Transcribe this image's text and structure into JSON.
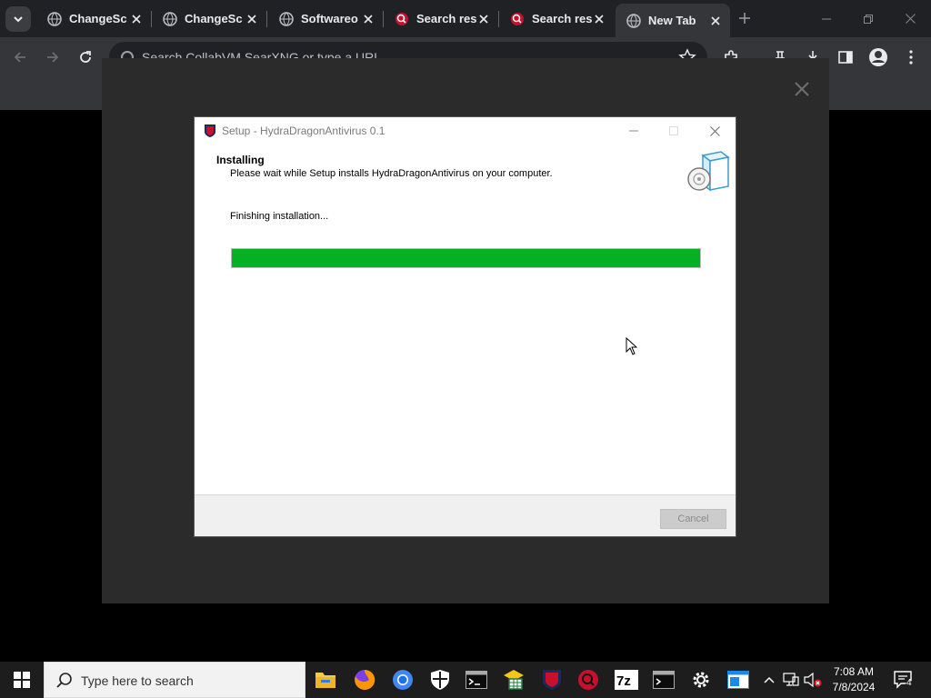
{
  "browser": {
    "tabs": [
      {
        "title": "ChangeSc",
        "favicon": "globe-icon",
        "active": false
      },
      {
        "title": "ChangeSc",
        "favicon": "globe-icon",
        "active": false
      },
      {
        "title": "Softwareo",
        "favicon": "globe-icon",
        "active": false
      },
      {
        "title": "Search res",
        "favicon": "searxng-icon",
        "active": false
      },
      {
        "title": "Search res",
        "favicon": "searxng-icon",
        "active": false
      },
      {
        "title": "New Tab",
        "favicon": "globe-icon",
        "active": true
      }
    ],
    "omnibox_placeholder": "Search CollabVM SearXNG or type a URL"
  },
  "setup_window": {
    "title": "Setup - HydraDragonAntivirus 0.1",
    "heading": "Installing",
    "subheading": "Please wait while Setup installs HydraDragonAntivirus on your computer.",
    "status": "Finishing installation...",
    "progress_fraction": 1.0,
    "progress_color": "#06b025",
    "cancel_label": "Cancel",
    "cancel_enabled": false
  },
  "taskbar": {
    "search_placeholder": "Type here to search",
    "pinned_apps": [
      "file-explorer-icon",
      "firefox-icon",
      "chrome-icon",
      "windows-security-icon",
      "terminal-icon",
      "spreadsheet-icon",
      "hydradragon-icon",
      "red-app-icon",
      "7zip-icon",
      "cmd-icon",
      "settings-icon",
      "blue-window-icon"
    ],
    "clock_time": "7:08 AM",
    "clock_date": "7/8/2024",
    "notification_count": "4"
  }
}
